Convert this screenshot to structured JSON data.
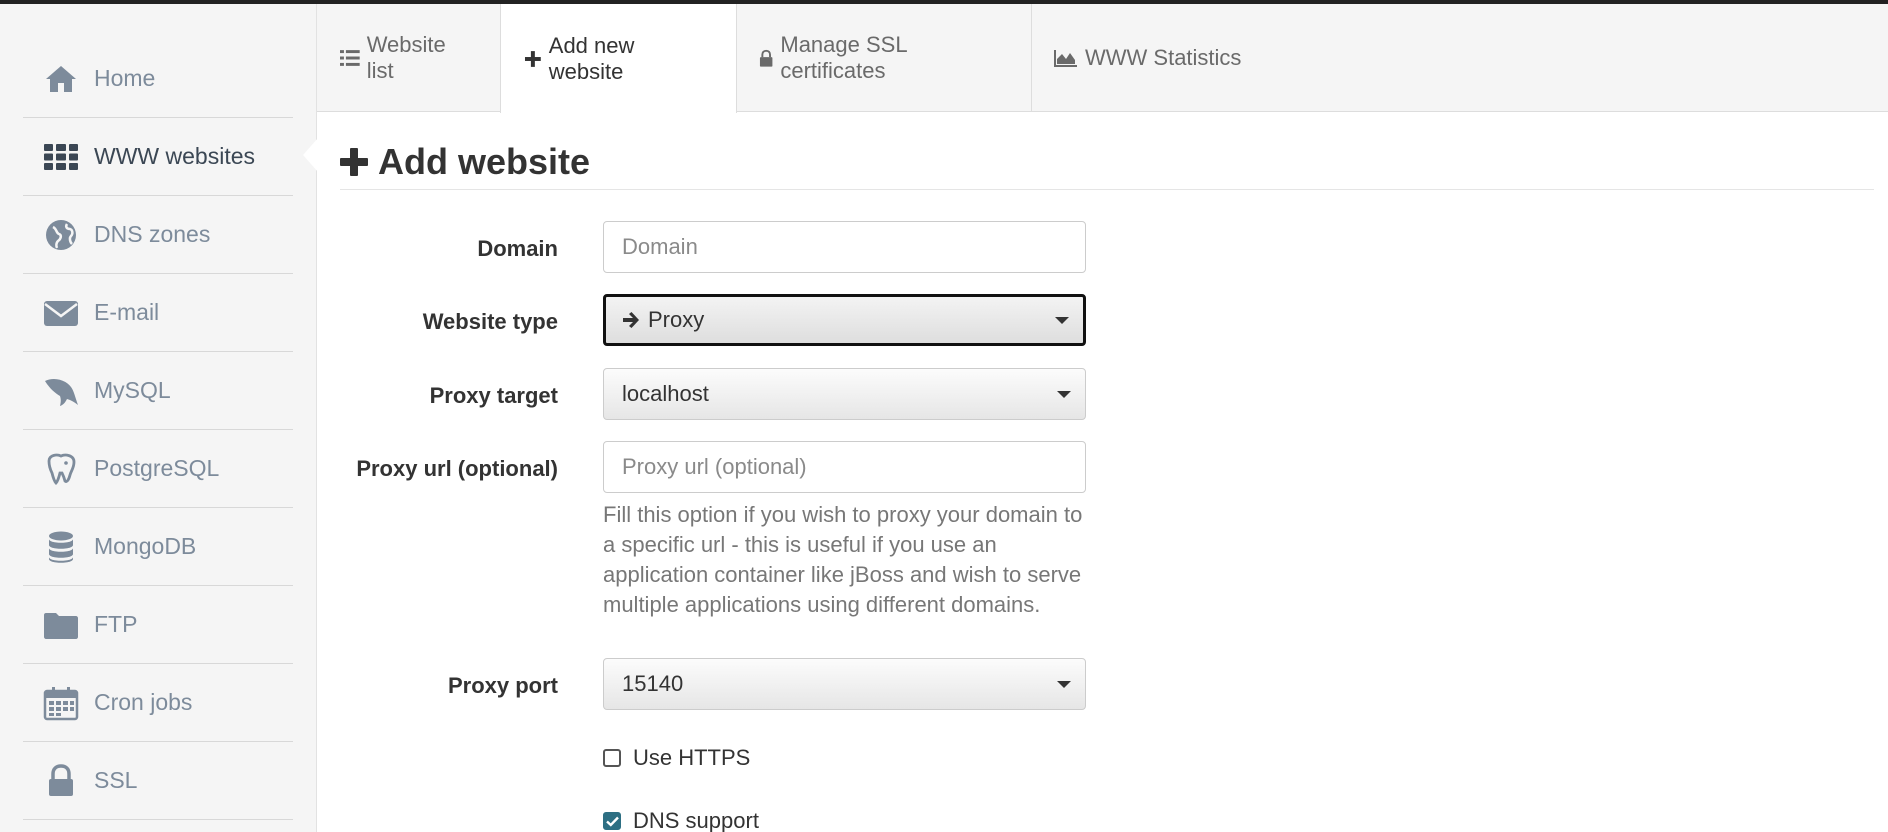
{
  "sidebar": {
    "items": [
      {
        "label": "Home",
        "icon": "home-icon"
      },
      {
        "label": "WWW websites",
        "icon": "grid-icon"
      },
      {
        "label": "DNS zones",
        "icon": "globe-icon"
      },
      {
        "label": "E-mail",
        "icon": "envelope-icon"
      },
      {
        "label": "MySQL",
        "icon": "dolphin-icon"
      },
      {
        "label": "PostgreSQL",
        "icon": "elephant-icon"
      },
      {
        "label": "MongoDB",
        "icon": "database-icon"
      },
      {
        "label": "FTP",
        "icon": "folder-icon"
      },
      {
        "label": "Cron jobs",
        "icon": "calendar-icon"
      },
      {
        "label": "SSL",
        "icon": "lock-icon"
      }
    ],
    "active": "WWW websites"
  },
  "tabs": [
    {
      "label": "Website list",
      "icon": "list-icon"
    },
    {
      "label": "Add new website",
      "icon": "plus-icon"
    },
    {
      "label": "Manage SSL certificates",
      "icon": "lock-icon"
    },
    {
      "label": "WWW Statistics",
      "icon": "area-chart-icon"
    }
  ],
  "page": {
    "title": "Add website"
  },
  "form": {
    "domain": {
      "label": "Domain",
      "placeholder": "Domain",
      "value": ""
    },
    "website_type": {
      "label": "Website type",
      "value": "Proxy"
    },
    "proxy_target": {
      "label": "Proxy target",
      "value": "localhost"
    },
    "proxy_url": {
      "label": "Proxy url (optional)",
      "placeholder": "Proxy url (optional)",
      "value": "",
      "help": "Fill this option if you wish to proxy your domain to a specific url - this is useful if you use an application container like jBoss and wish to serve multiple applications using different domains."
    },
    "proxy_port": {
      "label": "Proxy port",
      "value": "15140"
    },
    "use_https": {
      "label": "Use HTTPS",
      "checked": false
    },
    "dns_support": {
      "label": "DNS support",
      "checked": true
    }
  },
  "colors": {
    "sidebar_icon": "#7d8b9b",
    "sidebar_bg": "#f5f5f5",
    "checkbox_checked": "#2d6f83"
  }
}
